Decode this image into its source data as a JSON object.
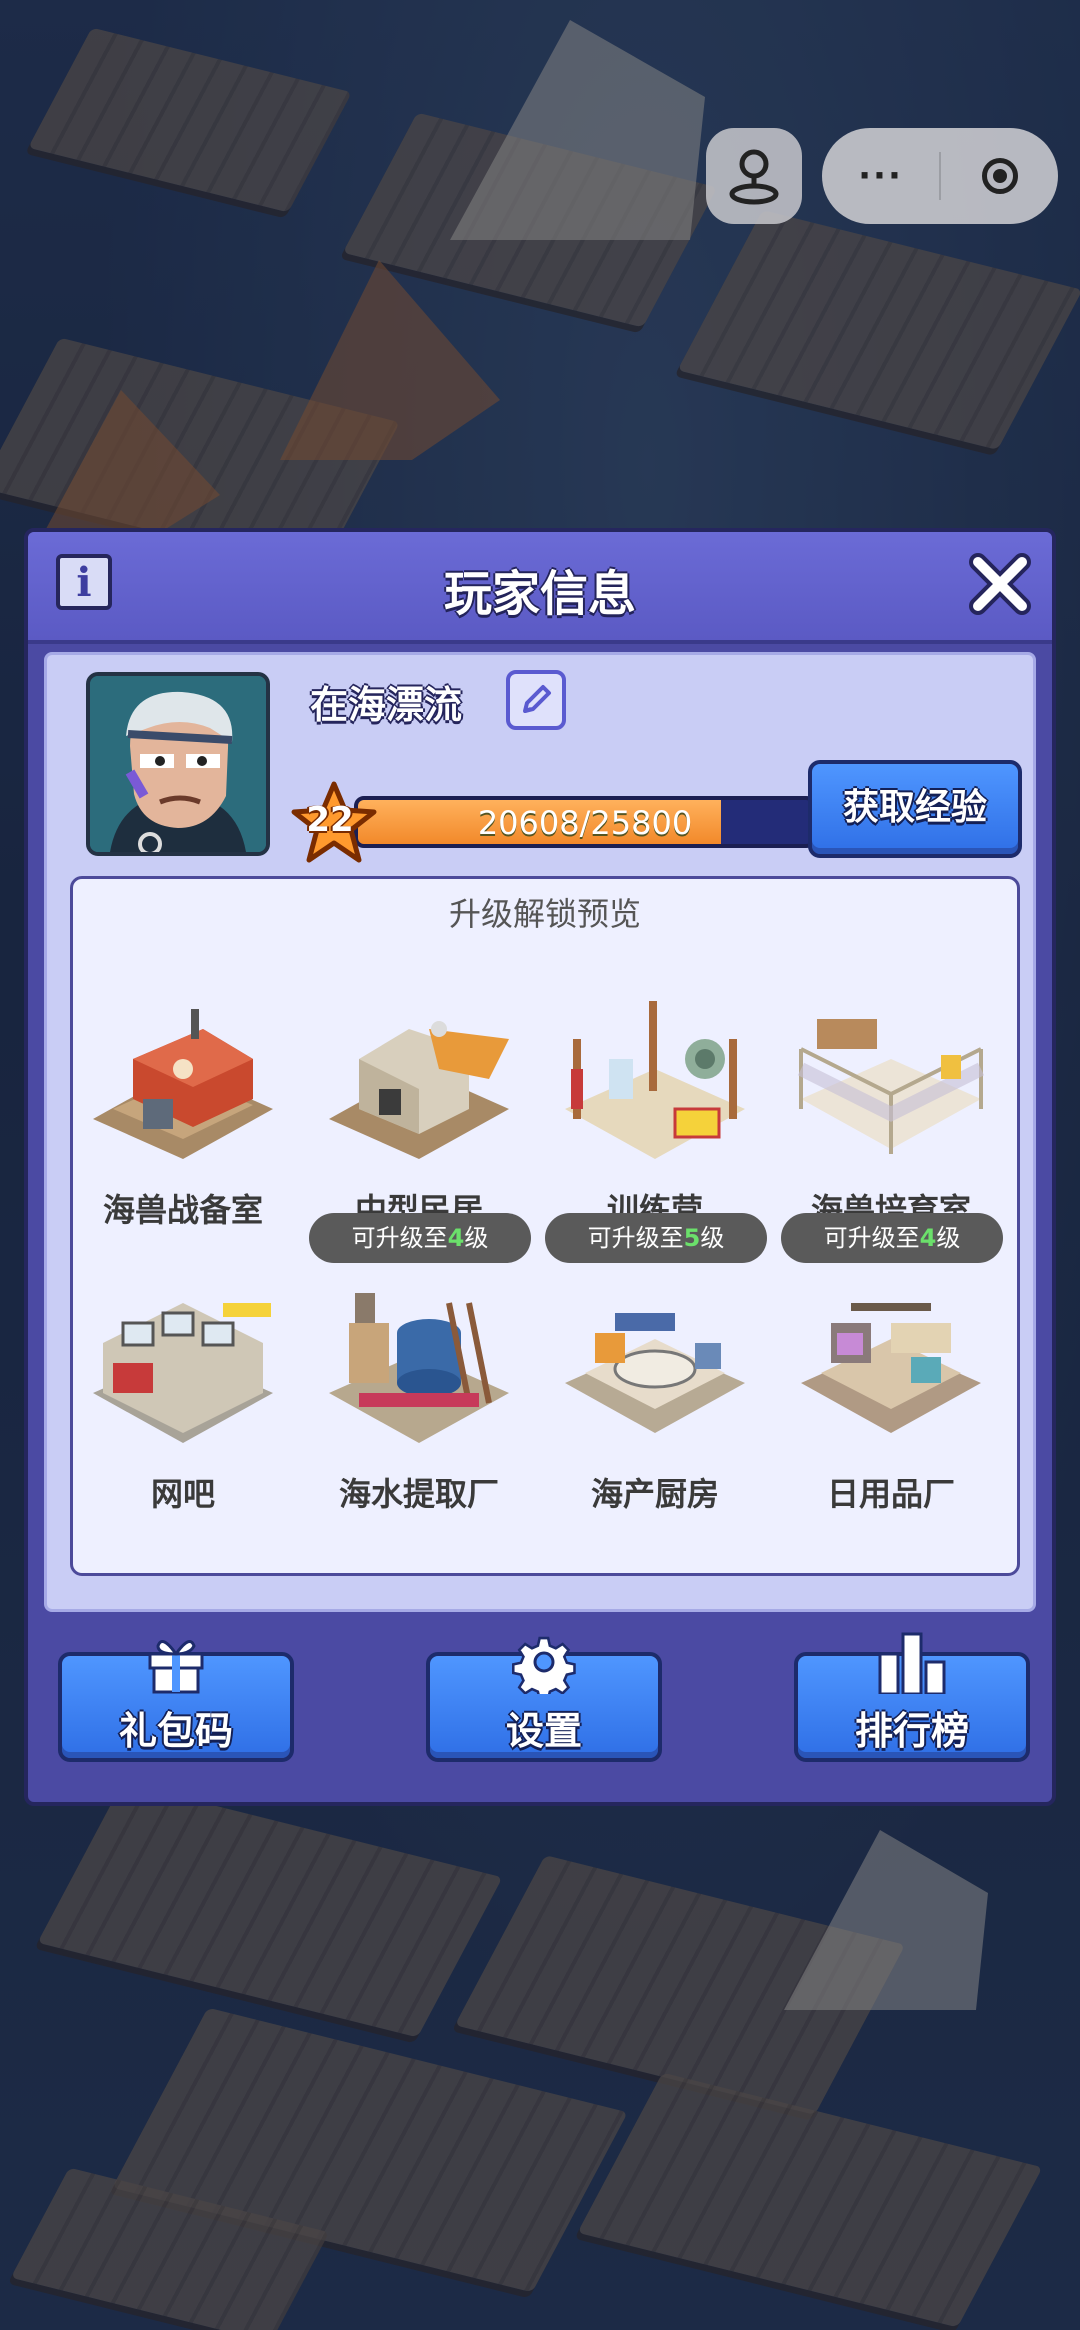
{
  "capsule": {
    "more_label": "···"
  },
  "dialog": {
    "title": "玩家信息",
    "info_icon_label": "i"
  },
  "player": {
    "name": "在海漂流",
    "level": "22",
    "xp_text": "20608/25800",
    "xp_progress": 0.799
  },
  "get_xp_label": "获取经验",
  "preview": {
    "title": "升级解锁预览",
    "buildings": [
      {
        "name": "海兽战备室",
        "badge": null
      },
      {
        "name": "中型民居",
        "badge": null
      },
      {
        "name": "训练营",
        "badge": null
      },
      {
        "name": "海兽培育室",
        "badge": null
      },
      {
        "name": "网吧",
        "badge": null
      },
      {
        "name": "海水提取厂",
        "badge": {
          "prefix": "可升级至",
          "level": "4",
          "suffix": "级"
        }
      },
      {
        "name": "海产厨房",
        "badge": {
          "prefix": "可升级至",
          "level": "5",
          "suffix": "级"
        }
      },
      {
        "name": "日用品厂",
        "badge": {
          "prefix": "可升级至",
          "level": "4",
          "suffix": "级"
        }
      }
    ]
  },
  "bottom": {
    "gift_label": "礼包码",
    "settings_label": "设置",
    "rank_label": "排行榜"
  },
  "colors": {
    "dialog_bg": "#4b4aa3",
    "header": "#6b6bd6",
    "button_blue": "#3a80f2",
    "xp_fill": "#f2892a",
    "badge_level": "#6be06b"
  }
}
